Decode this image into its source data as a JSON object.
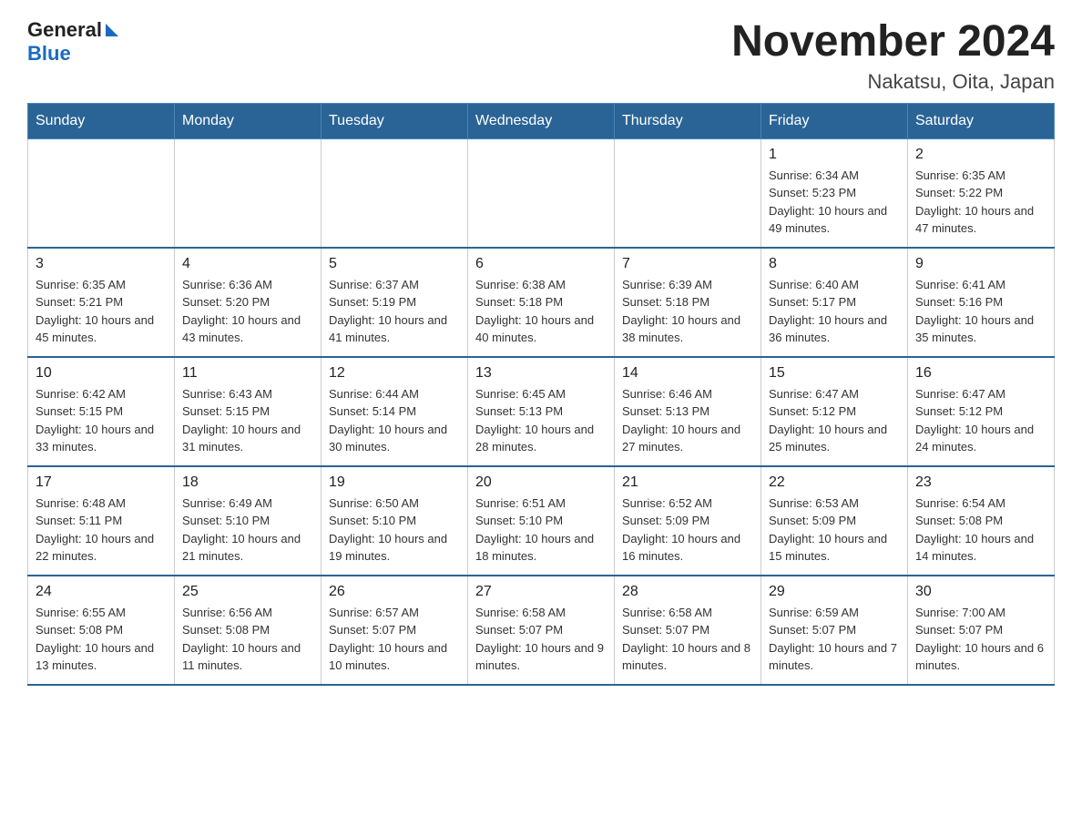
{
  "header": {
    "logo_general": "General",
    "logo_blue": "Blue",
    "month_title": "November 2024",
    "location": "Nakatsu, Oita, Japan"
  },
  "weekdays": [
    "Sunday",
    "Monday",
    "Tuesday",
    "Wednesday",
    "Thursday",
    "Friday",
    "Saturday"
  ],
  "weeks": [
    {
      "days": [
        {
          "num": "",
          "info": ""
        },
        {
          "num": "",
          "info": ""
        },
        {
          "num": "",
          "info": ""
        },
        {
          "num": "",
          "info": ""
        },
        {
          "num": "",
          "info": ""
        },
        {
          "num": "1",
          "info": "Sunrise: 6:34 AM\nSunset: 5:23 PM\nDaylight: 10 hours and 49 minutes."
        },
        {
          "num": "2",
          "info": "Sunrise: 6:35 AM\nSunset: 5:22 PM\nDaylight: 10 hours and 47 minutes."
        }
      ]
    },
    {
      "days": [
        {
          "num": "3",
          "info": "Sunrise: 6:35 AM\nSunset: 5:21 PM\nDaylight: 10 hours and 45 minutes."
        },
        {
          "num": "4",
          "info": "Sunrise: 6:36 AM\nSunset: 5:20 PM\nDaylight: 10 hours and 43 minutes."
        },
        {
          "num": "5",
          "info": "Sunrise: 6:37 AM\nSunset: 5:19 PM\nDaylight: 10 hours and 41 minutes."
        },
        {
          "num": "6",
          "info": "Sunrise: 6:38 AM\nSunset: 5:18 PM\nDaylight: 10 hours and 40 minutes."
        },
        {
          "num": "7",
          "info": "Sunrise: 6:39 AM\nSunset: 5:18 PM\nDaylight: 10 hours and 38 minutes."
        },
        {
          "num": "8",
          "info": "Sunrise: 6:40 AM\nSunset: 5:17 PM\nDaylight: 10 hours and 36 minutes."
        },
        {
          "num": "9",
          "info": "Sunrise: 6:41 AM\nSunset: 5:16 PM\nDaylight: 10 hours and 35 minutes."
        }
      ]
    },
    {
      "days": [
        {
          "num": "10",
          "info": "Sunrise: 6:42 AM\nSunset: 5:15 PM\nDaylight: 10 hours and 33 minutes."
        },
        {
          "num": "11",
          "info": "Sunrise: 6:43 AM\nSunset: 5:15 PM\nDaylight: 10 hours and 31 minutes."
        },
        {
          "num": "12",
          "info": "Sunrise: 6:44 AM\nSunset: 5:14 PM\nDaylight: 10 hours and 30 minutes."
        },
        {
          "num": "13",
          "info": "Sunrise: 6:45 AM\nSunset: 5:13 PM\nDaylight: 10 hours and 28 minutes."
        },
        {
          "num": "14",
          "info": "Sunrise: 6:46 AM\nSunset: 5:13 PM\nDaylight: 10 hours and 27 minutes."
        },
        {
          "num": "15",
          "info": "Sunrise: 6:47 AM\nSunset: 5:12 PM\nDaylight: 10 hours and 25 minutes."
        },
        {
          "num": "16",
          "info": "Sunrise: 6:47 AM\nSunset: 5:12 PM\nDaylight: 10 hours and 24 minutes."
        }
      ]
    },
    {
      "days": [
        {
          "num": "17",
          "info": "Sunrise: 6:48 AM\nSunset: 5:11 PM\nDaylight: 10 hours and 22 minutes."
        },
        {
          "num": "18",
          "info": "Sunrise: 6:49 AM\nSunset: 5:10 PM\nDaylight: 10 hours and 21 minutes."
        },
        {
          "num": "19",
          "info": "Sunrise: 6:50 AM\nSunset: 5:10 PM\nDaylight: 10 hours and 19 minutes."
        },
        {
          "num": "20",
          "info": "Sunrise: 6:51 AM\nSunset: 5:10 PM\nDaylight: 10 hours and 18 minutes."
        },
        {
          "num": "21",
          "info": "Sunrise: 6:52 AM\nSunset: 5:09 PM\nDaylight: 10 hours and 16 minutes."
        },
        {
          "num": "22",
          "info": "Sunrise: 6:53 AM\nSunset: 5:09 PM\nDaylight: 10 hours and 15 minutes."
        },
        {
          "num": "23",
          "info": "Sunrise: 6:54 AM\nSunset: 5:08 PM\nDaylight: 10 hours and 14 minutes."
        }
      ]
    },
    {
      "days": [
        {
          "num": "24",
          "info": "Sunrise: 6:55 AM\nSunset: 5:08 PM\nDaylight: 10 hours and 13 minutes."
        },
        {
          "num": "25",
          "info": "Sunrise: 6:56 AM\nSunset: 5:08 PM\nDaylight: 10 hours and 11 minutes."
        },
        {
          "num": "26",
          "info": "Sunrise: 6:57 AM\nSunset: 5:07 PM\nDaylight: 10 hours and 10 minutes."
        },
        {
          "num": "27",
          "info": "Sunrise: 6:58 AM\nSunset: 5:07 PM\nDaylight: 10 hours and 9 minutes."
        },
        {
          "num": "28",
          "info": "Sunrise: 6:58 AM\nSunset: 5:07 PM\nDaylight: 10 hours and 8 minutes."
        },
        {
          "num": "29",
          "info": "Sunrise: 6:59 AM\nSunset: 5:07 PM\nDaylight: 10 hours and 7 minutes."
        },
        {
          "num": "30",
          "info": "Sunrise: 7:00 AM\nSunset: 5:07 PM\nDaylight: 10 hours and 6 minutes."
        }
      ]
    }
  ]
}
